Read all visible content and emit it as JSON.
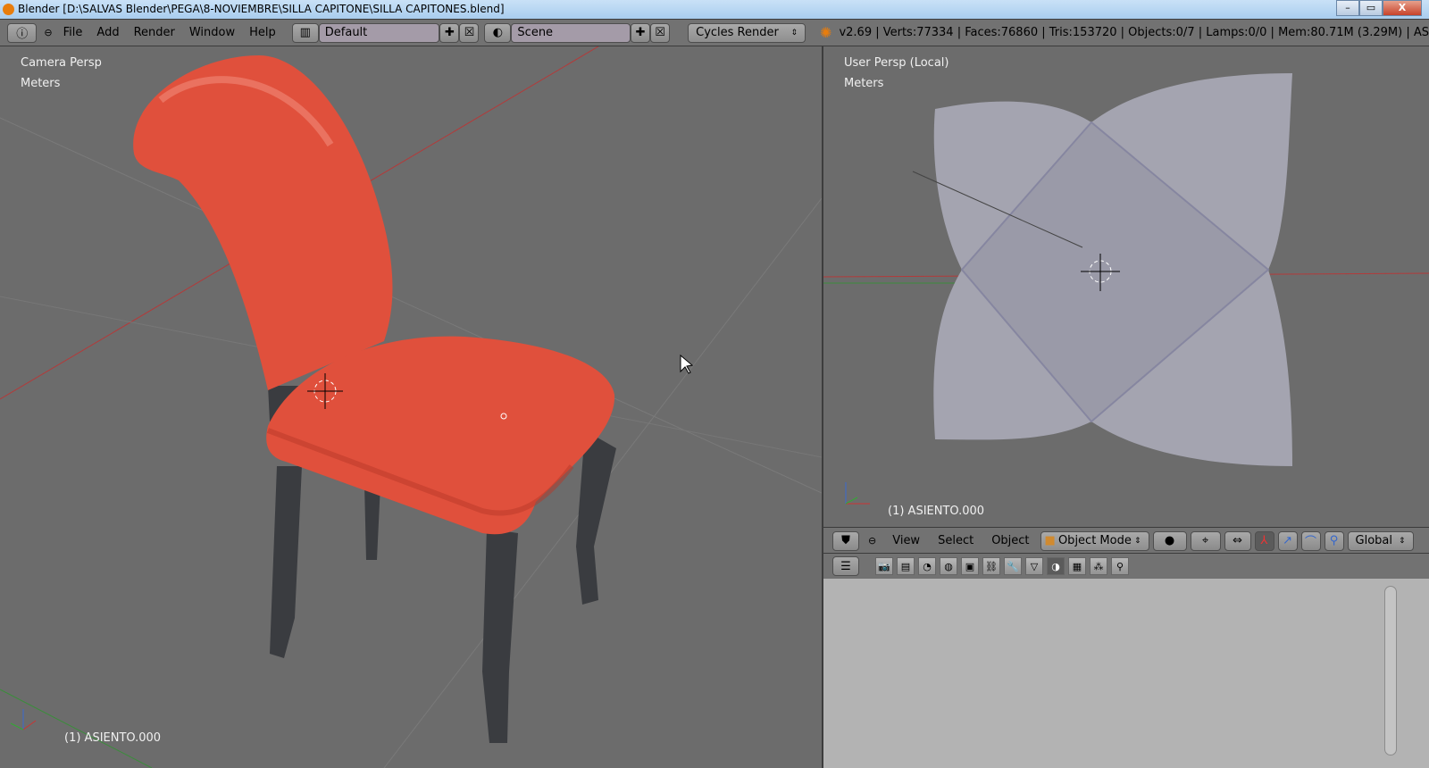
{
  "window": {
    "title": "Blender [D:\\SALVAS Blender\\PEGA\\8-NOVIEMBRE\\SILLA CAPITONE\\SILLA CAPITONES.blend]",
    "minimize": "–",
    "maximize": "▭",
    "close": "X"
  },
  "menu": {
    "items": [
      "File",
      "Add",
      "Render",
      "Window",
      "Help"
    ]
  },
  "screen_layout": "Default",
  "scene": "Scene",
  "render_engine": "Cycles Render",
  "stats": "v2.69 | Verts:77334 | Faces:76860 | Tris:153720 | Objects:0/7 | Lamps:0/0 | Mem:80.71M (3.29M) | AS",
  "left_view": {
    "title": "Camera Persp",
    "units": "Meters",
    "object": "(1) ASIENTO.000"
  },
  "right_view": {
    "title": "User Persp (Local)",
    "units": "Meters",
    "object": "(1) ASIENTO.000"
  },
  "view3d_header": {
    "view": "View",
    "select": "Select",
    "object": "Object",
    "mode": "Object Mode",
    "orientation": "Global"
  },
  "colors": {
    "chair": "#e0503c",
    "legs": "#3a3c40",
    "viewport": "#6c6c6c",
    "cushion": "#a4a4b0"
  }
}
